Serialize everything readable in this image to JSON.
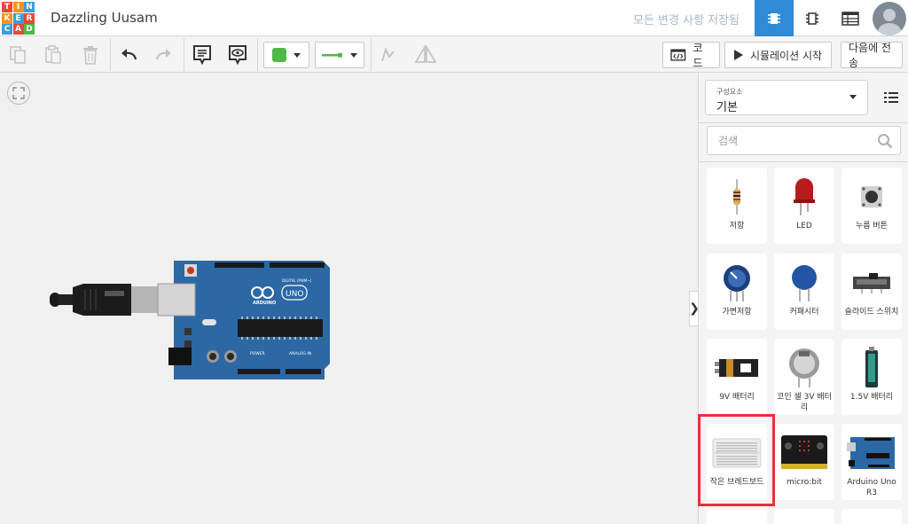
{
  "app": {
    "logo_letters": [
      "T",
      "I",
      "N",
      "K",
      "E",
      "R",
      "C",
      "A",
      "D"
    ],
    "project_title": "Dazzling Uusam",
    "save_status": "모든 변경 사항 저장됨"
  },
  "header": {
    "buttons": [
      {
        "name": "circuit-view-icon",
        "active": true
      },
      {
        "name": "schematic-view-icon",
        "active": false
      },
      {
        "name": "component-list-icon",
        "active": false
      }
    ]
  },
  "toolbar": {
    "code_label": "코드",
    "simulate_label": "시뮬레이션 시작",
    "send_label": "다음에 전송",
    "fill_color": "#4fb848",
    "wire_color": "#4fb848"
  },
  "panel": {
    "category_caption": "구성요소",
    "category_value": "기본",
    "search_placeholder": "검색",
    "components": [
      {
        "label": "저항",
        "icon": "resistor-icon"
      },
      {
        "label": "LED",
        "icon": "led-icon"
      },
      {
        "label": "누름 버튼",
        "icon": "pushbutton-icon"
      },
      {
        "label": "가변저항",
        "icon": "potentiometer-icon"
      },
      {
        "label": "커패시터",
        "icon": "capacitor-icon"
      },
      {
        "label": "슬라이드 스위치",
        "icon": "slide-switch-icon"
      },
      {
        "label": "9V 배터리",
        "icon": "battery-9v-icon"
      },
      {
        "label": "코인 셀 3V 배터리",
        "icon": "coin-cell-icon"
      },
      {
        "label": "1.5V 배터리",
        "icon": "battery-aa-icon"
      },
      {
        "label": "작은 브레드보드",
        "icon": "breadboard-icon"
      },
      {
        "label": "micro:bit",
        "icon": "microbit-icon"
      },
      {
        "label": "Arduino Uno R3",
        "icon": "arduino-uno-icon"
      }
    ]
  },
  "board": {
    "brand": "ARDUINO",
    "model": "UNO",
    "digital_label": "DIGITAL (PWM~)",
    "power_label": "POWER",
    "analog_label": "ANALOG IN"
  }
}
